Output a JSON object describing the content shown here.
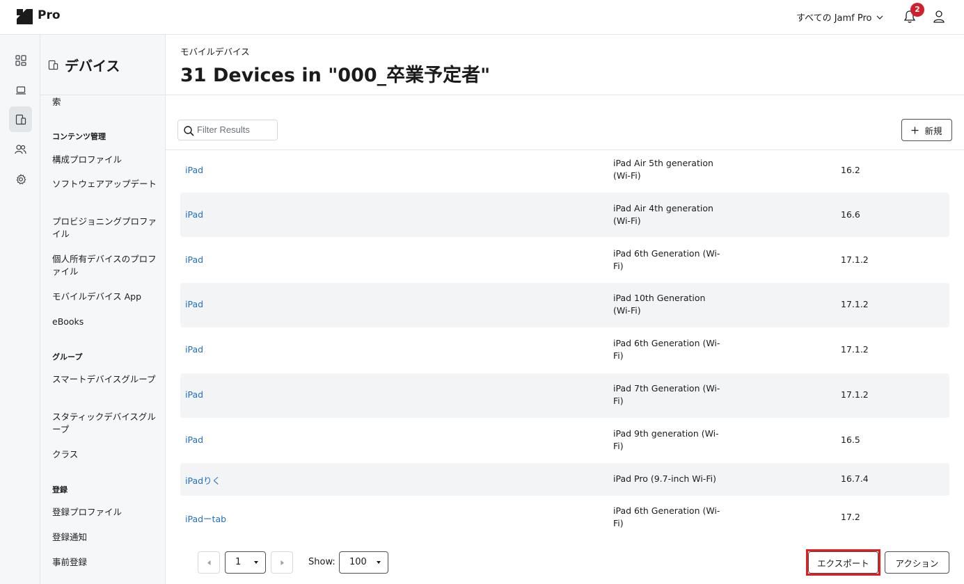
{
  "app": {
    "brand": "Pro",
    "env_selector": "すべての Jamf Pro",
    "notification_count": "2"
  },
  "rail": {
    "icons": [
      "dashboard-icon",
      "computers-icon",
      "devices-icon",
      "users-icon",
      "settings-icon"
    ],
    "active": "devices-icon"
  },
  "sidenav": {
    "title": "デバイス",
    "partial_item": "索",
    "sections": [
      {
        "heading": "コンテンツ管理",
        "items": [
          "構成プロファイル",
          "ソフトウェアアップデート",
          "プロビジョニングプロファイル",
          "個人所有デバイスのプロファイル",
          "モバイルデバイス App",
          "eBooks"
        ]
      },
      {
        "heading": "グループ",
        "items": [
          "スマートデバイスグループ",
          "スタティックデバイスグループ",
          "クラス"
        ]
      },
      {
        "heading": "登録",
        "items": [
          "登録プロファイル",
          "登録通知",
          "事前登録"
        ]
      }
    ]
  },
  "header": {
    "breadcrumb": "モバイルデバイス",
    "title": "31 Devices in \"000_卒業予定者\""
  },
  "toolbar": {
    "filter_placeholder": "Filter Results",
    "new_label": "新規"
  },
  "table": {
    "rows": [
      {
        "name": "iPad",
        "model": "iPad Air 5th generation (Wi-Fi)",
        "os": "16.2"
      },
      {
        "name": "iPad",
        "model": "iPad Air 4th generation (Wi-Fi)",
        "os": "16.6"
      },
      {
        "name": "iPad",
        "model": "iPad 6th Generation (Wi-Fi)",
        "os": "17.1.2"
      },
      {
        "name": "iPad",
        "model": "iPad 10th Generation (Wi-Fi)",
        "os": "17.1.2"
      },
      {
        "name": "iPad",
        "model": "iPad 6th Generation (Wi-Fi)",
        "os": "17.1.2"
      },
      {
        "name": "iPad",
        "model": "iPad 7th Generation (Wi-Fi)",
        "os": "17.1.2"
      },
      {
        "name": "iPad",
        "model": "iPad 9th generation (Wi-Fi)",
        "os": "16.5"
      },
      {
        "name": "iPadりく",
        "model": "iPad Pro (9.7-inch Wi-Fi)",
        "os": "16.7.4"
      },
      {
        "name": "iPadーtab",
        "model": "iPad 6th Generation (Wi-Fi)",
        "os": "17.2"
      }
    ]
  },
  "footer": {
    "page": "1",
    "show_label": "Show:",
    "page_size": "100",
    "export_label": "エクスポート",
    "action_label": "アクション"
  },
  "colors": {
    "link": "#1f6fc5",
    "badge": "#d1202d",
    "highlight": "#e0201f",
    "row_alt": "#f2f4f5"
  }
}
